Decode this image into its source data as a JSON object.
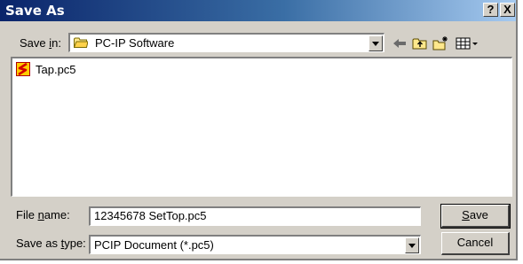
{
  "window": {
    "title": "Save As",
    "help_label": "?",
    "close_label": "X"
  },
  "save_in": {
    "label_pre": "Save ",
    "label_accel": "i",
    "label_post": "n:",
    "value": "PC-IP Software"
  },
  "toolbar": {
    "icons": [
      "back-arrow-icon",
      "up-folder-icon",
      "new-folder-icon",
      "view-menu-icon"
    ]
  },
  "files": [
    {
      "name": "Tap.pc5",
      "icon": "pc5-file-icon"
    }
  ],
  "file_name": {
    "label_pre": "File ",
    "label_accel": "n",
    "label_post": "ame:",
    "value": "12345678 SetTop.pc5"
  },
  "save_as_type": {
    "label_pre": "Save as ",
    "label_accel": "t",
    "label_post": "ype:",
    "value": "PCIP Document (*.pc5)"
  },
  "buttons": {
    "save_accel": "S",
    "save_rest": "ave",
    "cancel": "Cancel"
  },
  "colors": {
    "title_start": "#0a246a",
    "title_end": "#a6caf0",
    "face": "#d4d0c8"
  }
}
